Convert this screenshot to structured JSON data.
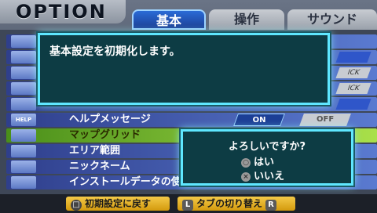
{
  "header": {
    "title": "OPTION",
    "tabs": [
      {
        "label": "基本"
      },
      {
        "label": "操作"
      },
      {
        "label": "サウンド"
      }
    ]
  },
  "list": {
    "rows": [
      {
        "icon": "HELP",
        "label": "ヘルプメッセージ",
        "on": "ON",
        "off": "OFF"
      },
      {
        "icon": "",
        "label": "マップグリッド"
      },
      {
        "icon": "",
        "label": "エリア範囲"
      },
      {
        "icon": "",
        "label": "ニックネーム"
      },
      {
        "icon": "",
        "label": "インストールデータの使用"
      }
    ],
    "right_pills": [
      "ICK",
      "ICK"
    ]
  },
  "dialog": {
    "message": "基本設定を初期化します。"
  },
  "confirm": {
    "question": "よろしいですか?",
    "yes": "はい",
    "no": "いいえ"
  },
  "footer": {
    "reset_label": "初期設定に戻す",
    "tab_switch_label": "タブの切り替え",
    "l_key": "L",
    "r_key": "R"
  }
}
